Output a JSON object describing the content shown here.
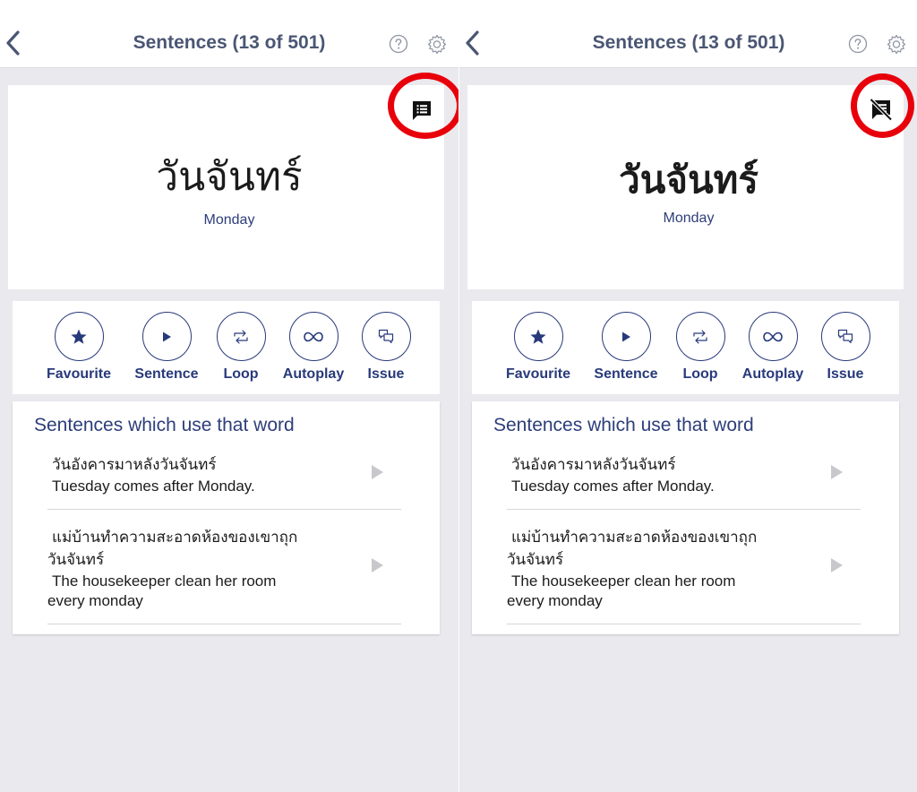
{
  "nav": {
    "title": "Sentences (13 of 501)",
    "back_icon": "chevron-left-icon",
    "help_icon": "question-circle-icon",
    "settings_icon": "gear-icon"
  },
  "word": {
    "thai": "วันจันทร์",
    "english": "Monday"
  },
  "panels": {
    "left": {
      "toggle_icon": "message-icon"
    },
    "right": {
      "toggle_icon": "message-off-icon"
    }
  },
  "actions": [
    {
      "label": "Favourite",
      "icon": "star-icon"
    },
    {
      "label": "Sentence",
      "icon": "play-icon"
    },
    {
      "label": "Loop",
      "icon": "repeat-icon"
    },
    {
      "label": "Autoplay",
      "icon": "infinity-icon"
    },
    {
      "label": "Issue",
      "icon": "chat-bubbles-icon"
    }
  ],
  "sentences": {
    "heading": "Sentences which use that word",
    "items": [
      {
        "thai": "วันอังคารมาหลังวันจันทร์",
        "english": "Tuesday comes after Monday."
      },
      {
        "thai_line1": "แม่บ้านทำความสะอาดห้องของเขาถุก",
        "thai_line2": "วันจันทร์",
        "english_line1": "The housekeeper clean her room",
        "english_line2": "every monday"
      }
    ]
  },
  "colors": {
    "accent": "#283a7b",
    "nav_title": "#4a5673",
    "highlight": "#e8000b",
    "background": "#e9e9ee"
  }
}
